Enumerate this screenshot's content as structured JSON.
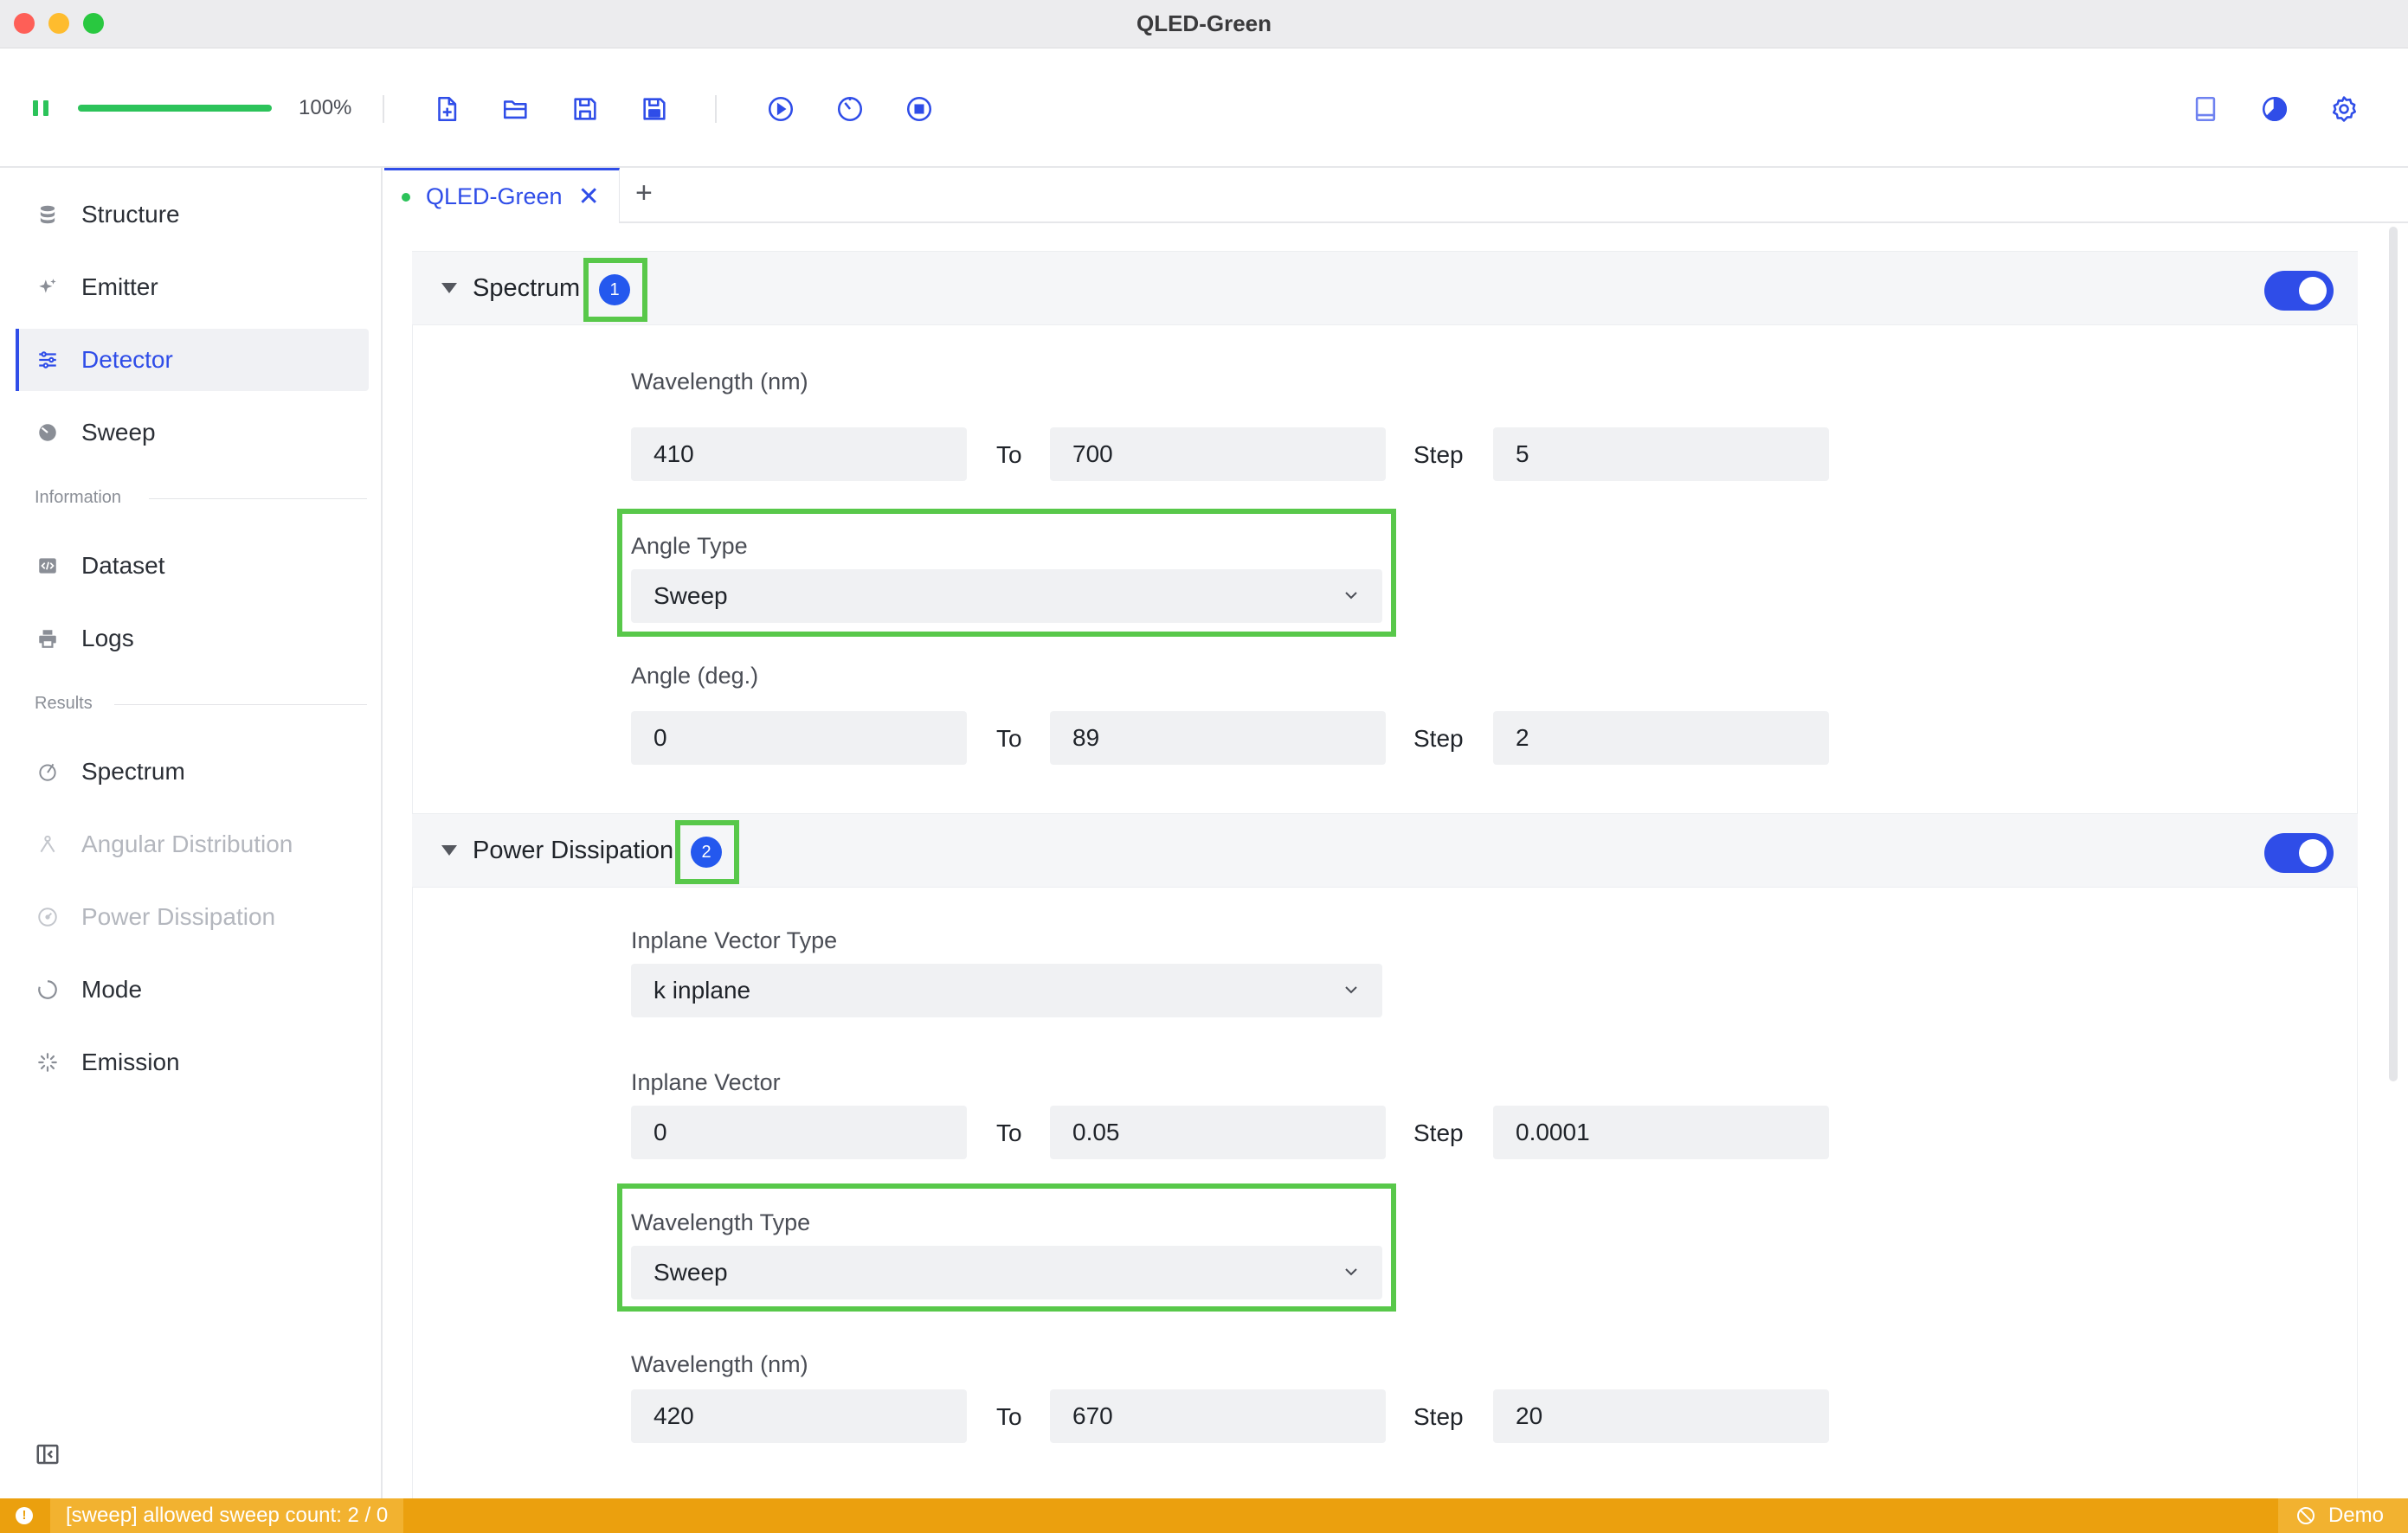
{
  "window": {
    "title": "QLED-Green"
  },
  "toolbar": {
    "progress_percent": 100,
    "progress_text": "100%"
  },
  "sidebar": {
    "items": [
      {
        "label": "Structure"
      },
      {
        "label": "Emitter"
      },
      {
        "label": "Detector"
      },
      {
        "label": "Sweep"
      }
    ],
    "section_information": "Information",
    "info_items": [
      {
        "label": "Dataset"
      },
      {
        "label": "Logs"
      }
    ],
    "section_results": "Results",
    "result_items": [
      {
        "label": "Spectrum"
      },
      {
        "label": "Angular Distribution"
      },
      {
        "label": "Power Dissipation"
      },
      {
        "label": "Mode"
      },
      {
        "label": "Emission"
      }
    ]
  },
  "tabs": [
    {
      "label": "QLED-Green",
      "close": "✕"
    }
  ],
  "tab_add": "+",
  "spectrum": {
    "title": "Spectrum",
    "badge": "1",
    "wavelength_label": "Wavelength (nm)",
    "wavelength_from": "410",
    "wavelength_to": "700",
    "wavelength_step": "5",
    "angle_type_label": "Angle Type",
    "angle_type_value": "Sweep",
    "angle_label": "Angle (deg.)",
    "angle_from": "0",
    "angle_to": "89",
    "angle_step": "2"
  },
  "power": {
    "title": "Power Dissipation",
    "badge": "2",
    "inplane_type_label": "Inplane Vector Type",
    "inplane_type_value": "k inplane",
    "inplane_label": "Inplane Vector",
    "inplane_from": "0",
    "inplane_to": "0.05",
    "inplane_step": "0.0001",
    "wavelength_type_label": "Wavelength Type",
    "wavelength_type_value": "Sweep",
    "wavelength_label": "Wavelength (nm)",
    "wavelength_from": "420",
    "wavelength_to": "670",
    "wavelength_step": "20"
  },
  "labels": {
    "to": "To",
    "step": "Step"
  },
  "status": {
    "message": "[sweep] allowed sweep count: 2 / 0",
    "mode": "Demo"
  },
  "colors": {
    "accent": "#2f4de8",
    "success": "#2cc35a",
    "warning": "#eba00e",
    "highlight": "#58c84a",
    "badge": "#2458ee"
  }
}
